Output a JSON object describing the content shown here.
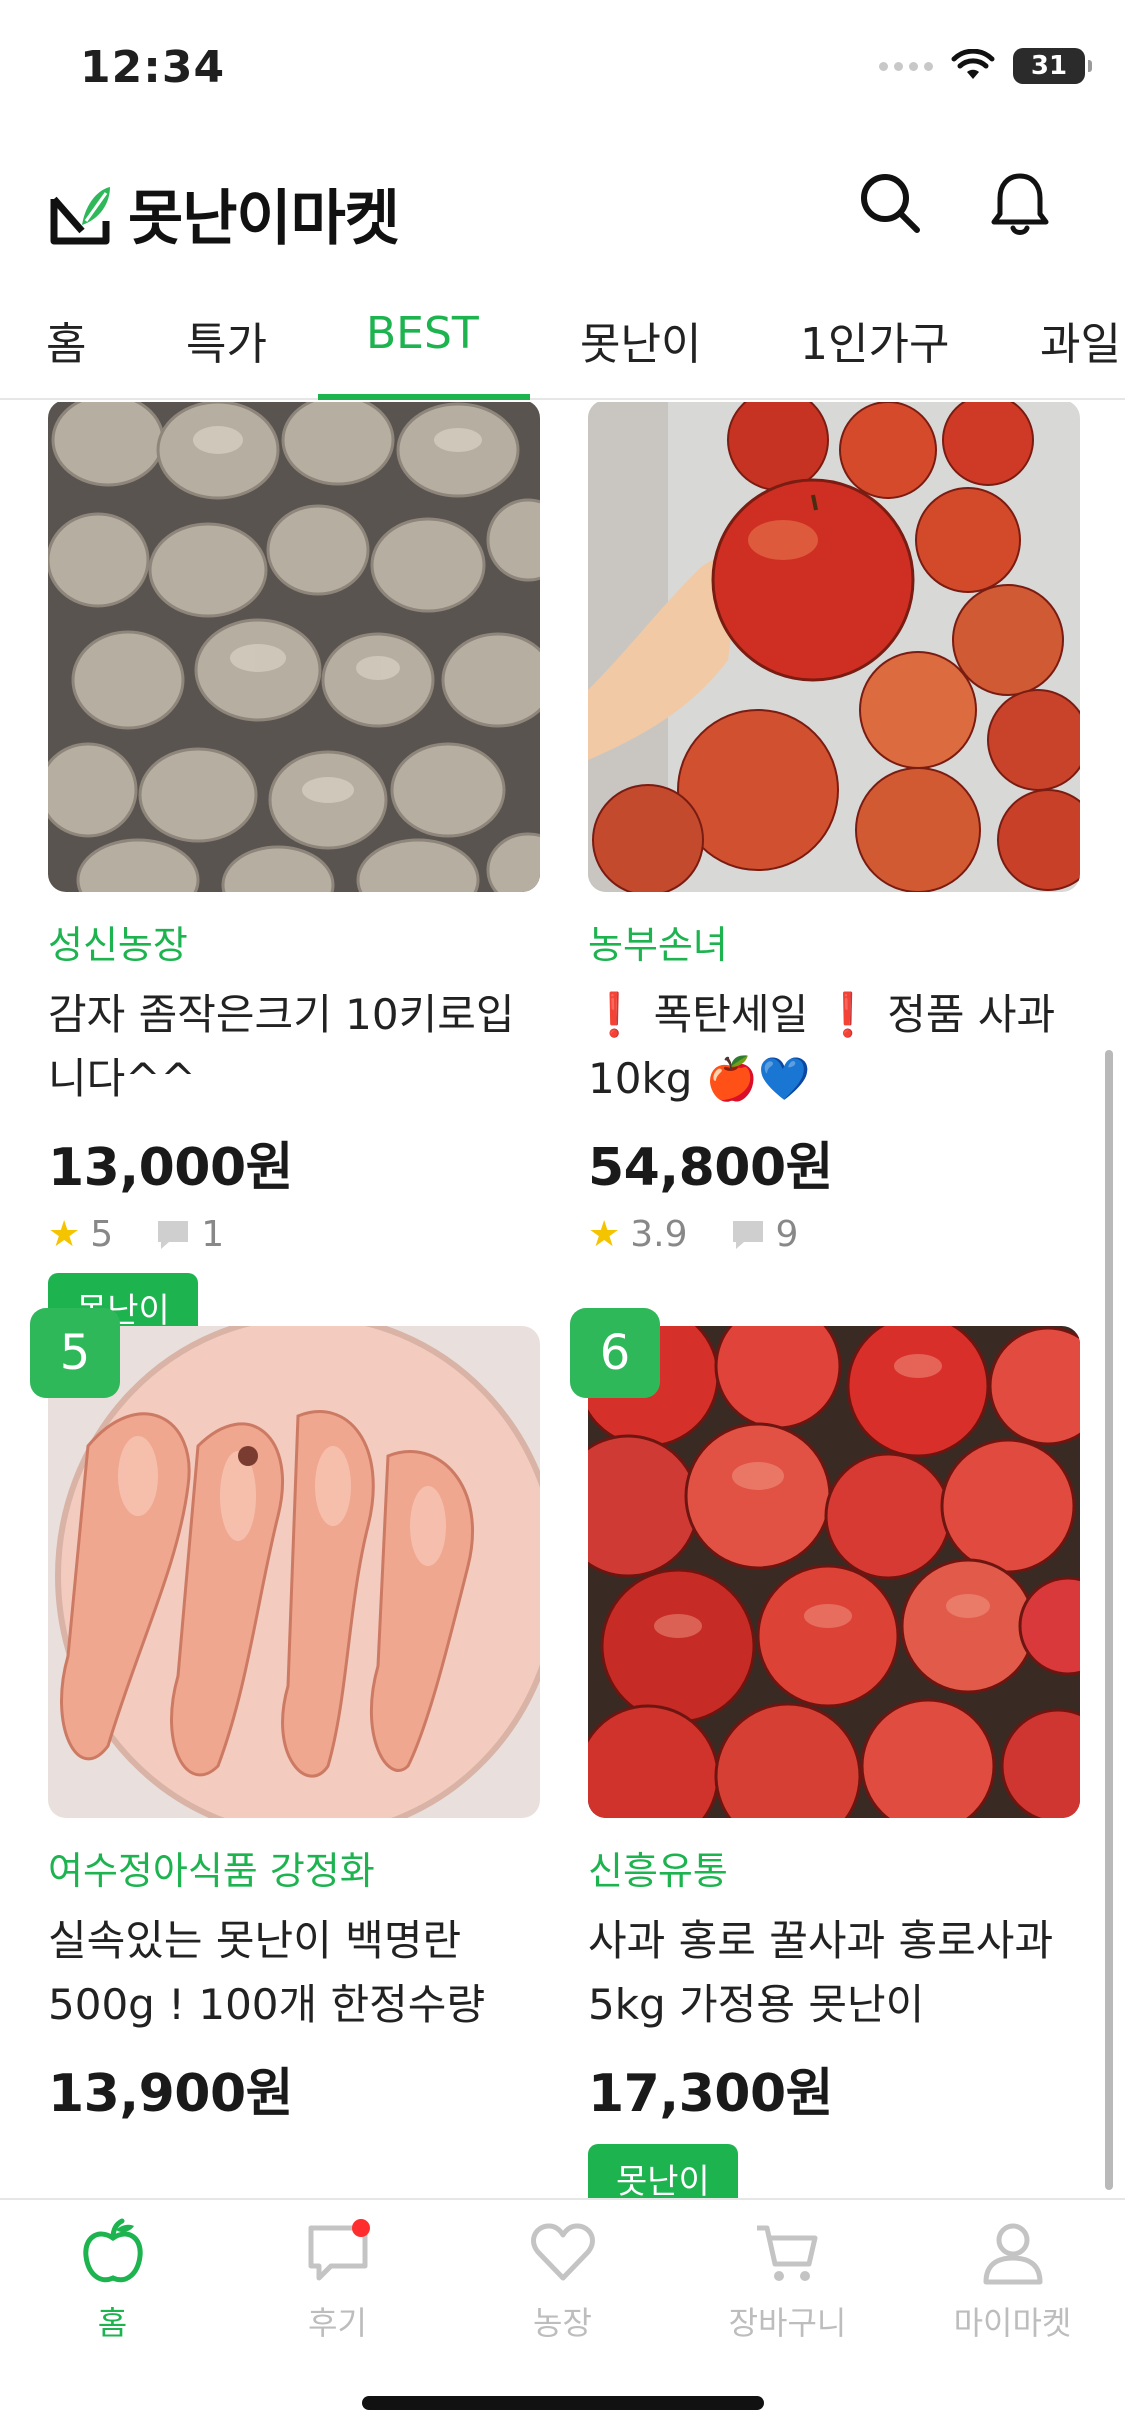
{
  "status_bar": {
    "time": "12:34",
    "battery": "31"
  },
  "header": {
    "title": "못난이마켓"
  },
  "tabs": [
    {
      "label": "홈",
      "active": false
    },
    {
      "label": "특가",
      "active": false
    },
    {
      "label": "BEST",
      "active": true
    },
    {
      "label": "못난이",
      "active": false
    },
    {
      "label": "1인가구",
      "active": false
    },
    {
      "label": "과일",
      "active": false
    }
  ],
  "products": [
    {
      "rank": "",
      "farm": "성신농장",
      "title": "감자 좀작은크기 10키로입니다^^",
      "price": "13,000원",
      "rating": "5",
      "reviews": "1",
      "tag": "못난이"
    },
    {
      "rank": "",
      "farm": "농부손녀",
      "title": "❗️ 폭탄세일 ❗️ 정품 사과 10kg 🍎💙",
      "price": "54,800원",
      "rating": "3.9",
      "reviews": "9",
      "tag": ""
    },
    {
      "rank": "5",
      "farm": "여수정아식품 강정화",
      "title": "실속있는 못난이 백명란 500g ! 100개 한정수량",
      "price": "13,900원",
      "rating": "",
      "reviews": "",
      "tag": ""
    },
    {
      "rank": "6",
      "farm": "신흥유통",
      "title": "사과 홍로 꿀사과 홍로사과 5kg 가정용 못난이",
      "price": "17,300원",
      "rating": "",
      "reviews": "",
      "tag": "못난이"
    }
  ],
  "bottom_nav": [
    {
      "label": "홈",
      "icon": "apple-icon",
      "active": true
    },
    {
      "label": "후기",
      "icon": "chat-bubble-icon",
      "active": false,
      "badge": true
    },
    {
      "label": "농장",
      "icon": "heart-icon",
      "active": false
    },
    {
      "label": "장바구니",
      "icon": "cart-icon",
      "active": false
    },
    {
      "label": "마이마켓",
      "icon": "user-icon",
      "active": false
    }
  ],
  "colors": {
    "accent": "#1db34f",
    "badge_red": "#ff2d2d",
    "inactive": "#bdbdbd"
  }
}
